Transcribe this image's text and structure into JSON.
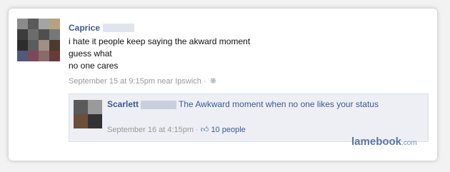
{
  "post": {
    "author": "Caprice",
    "text_lines": [
      "i hate it people keep saying the akward moment",
      "guess what",
      "no one cares"
    ],
    "meta": "September 15 at 9:15pm near Ipswich",
    "meta_sep": "·"
  },
  "comment": {
    "author": "Scarlett",
    "text": "The Awkward moment when no one likes your status",
    "meta": "September 16 at 4:15pm",
    "meta_sep": "·",
    "likes": "10 people"
  },
  "watermark": {
    "main": "lamebook",
    "suffix": ".com"
  },
  "avatar_colors": {
    "main": [
      "#8a8a8a",
      "#5a5a5a",
      "#a4a4a4",
      "#b7a27f",
      "#3c3c3c",
      "#6c6c6c",
      "#4f4f4f",
      "#777777",
      "#2d2d2d",
      "#5c5c5c",
      "#9f8f84",
      "#4a3a2f",
      "#4d5a7a",
      "#7a4a5a",
      "#8a6a6a",
      "#6a3a3a"
    ],
    "reply": [
      "#5a5a5a",
      "#9a9a9a",
      "#6b4f3a",
      "#333333"
    ]
  },
  "icons": {
    "gear": "gear-icon",
    "like": "thumbs-up-icon"
  }
}
